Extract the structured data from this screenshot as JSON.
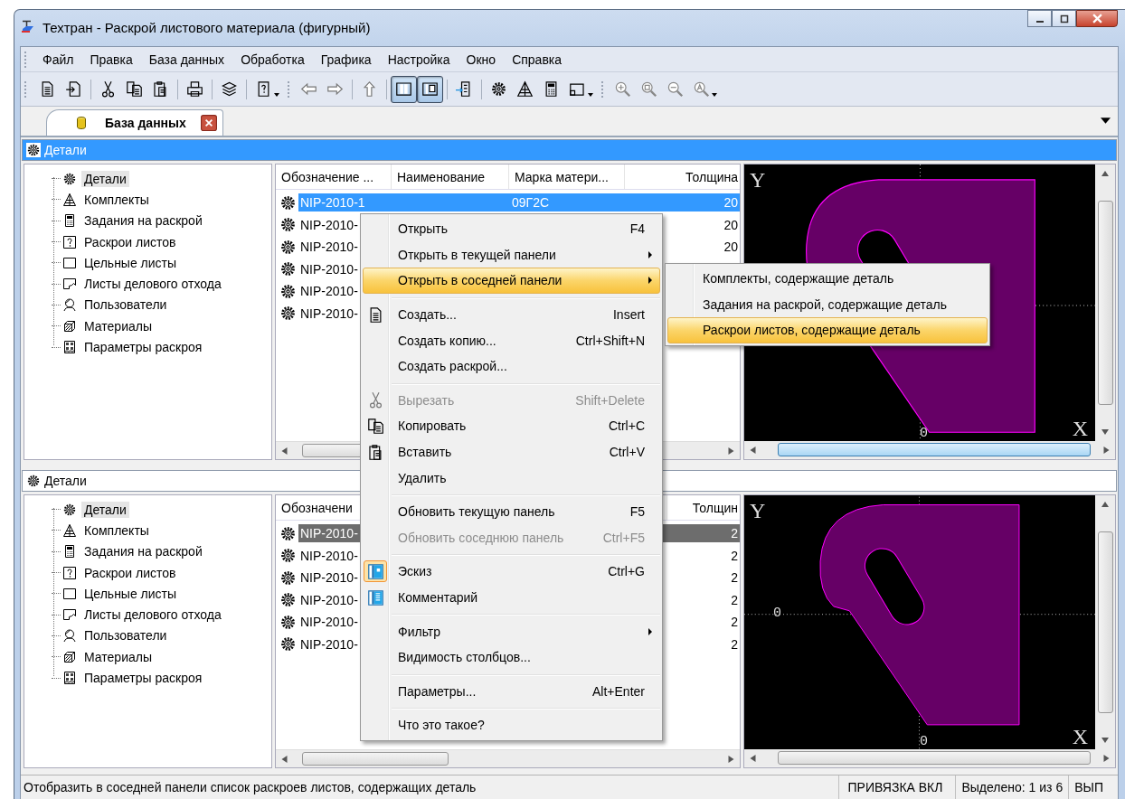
{
  "window": {
    "title": "Техтран - Раскрой листового материала (фигурный)"
  },
  "menu_bar": [
    "Файл",
    "Правка",
    "База данных",
    "Обработка",
    "Графика",
    "Настройка",
    "Окно",
    "Справка"
  ],
  "toolbar": [
    {
      "pressed": false
    },
    {
      "pressed": false
    },
    {
      "pressed": false
    },
    {
      "pressed": false
    },
    {
      "pressed": false
    },
    {
      "pressed": false
    },
    {
      "pressed": false
    },
    {
      "pressed": false
    },
    {
      "pressed": false
    },
    {
      "pressed": false
    },
    {
      "pressed": false
    },
    {
      "pressed": true
    },
    {
      "pressed": true
    },
    {
      "pressed": false
    },
    {
      "pressed": false
    },
    {
      "pressed": false
    },
    {
      "pressed": false
    },
    {
      "pressed": false
    },
    {
      "pressed": false
    },
    {
      "pressed": false
    },
    {
      "pressed": false
    },
    {
      "pressed": false
    }
  ],
  "tabs": [
    {
      "label": "База данных",
      "selected": true
    }
  ],
  "panels": [
    {
      "title": "Детали",
      "active": true,
      "tree": [
        {
          "label": "Детали",
          "selected": true
        },
        {
          "label": "Комплекты",
          "selected": false
        },
        {
          "label": "Задания на раскрой",
          "selected": false
        },
        {
          "label": "Раскрои листов",
          "selected": false
        },
        {
          "label": "Цельные листы",
          "selected": false
        },
        {
          "label": "Листы делового отхода",
          "selected": false
        },
        {
          "label": "Пользователи",
          "selected": false
        },
        {
          "label": "Материалы",
          "selected": false
        },
        {
          "label": "Параметры раскроя",
          "selected": false
        }
      ],
      "table": {
        "columns": [
          "Обозначение ...",
          "Наименование",
          "Марка матери...",
          "Толщина"
        ],
        "rows": [
          {
            "designation": "NIP-2010-1",
            "material": "09Г2С",
            "thickness": "20",
            "selected": true
          },
          {
            "designation": "NIP-2010-",
            "thickness": "20",
            "selected": false
          },
          {
            "designation": "NIP-2010-",
            "thickness": "20",
            "selected": false
          },
          {
            "designation": "NIP-2010-",
            "selected": false
          },
          {
            "designation": "NIP-2010-",
            "selected": false
          },
          {
            "designation": "NIP-2010-",
            "selected": false
          }
        ]
      },
      "preview": {
        "axis_labels": [
          {
            "text": "Y",
            "kind": "y-axis"
          },
          {
            "text": "0",
            "kind": "x-origin"
          },
          {
            "text": "X",
            "kind": "x-axis"
          }
        ]
      }
    },
    {
      "title": "Детали",
      "active": false,
      "tree": [
        {
          "label": "Детали",
          "selected": true
        },
        {
          "label": "Комплекты",
          "selected": false
        },
        {
          "label": "Задания на раскрой",
          "selected": false
        },
        {
          "label": "Раскрои листов",
          "selected": false
        },
        {
          "label": "Цельные листы",
          "selected": false
        },
        {
          "label": "Листы делового отхода",
          "selected": false
        },
        {
          "label": "Пользователи",
          "selected": false
        },
        {
          "label": "Материалы",
          "selected": false
        },
        {
          "label": "Параметры раскроя",
          "selected": false
        }
      ],
      "table": {
        "columns": [
          "Обозначени",
          "Толщин"
        ],
        "rows": [
          {
            "designation": "NIP-2010-",
            "thickness": "2",
            "selected": true
          },
          {
            "designation": "NIP-2010-",
            "thickness": "2",
            "selected": false
          },
          {
            "designation": "NIP-2010-",
            "thickness": "2",
            "selected": false
          },
          {
            "designation": "NIP-2010-",
            "thickness": "2",
            "selected": false
          },
          {
            "designation": "NIP-2010-",
            "thickness": "2",
            "selected": false
          },
          {
            "designation": "NIP-2010-",
            "thickness": "2",
            "selected": false
          }
        ]
      },
      "preview": {
        "axis_labels": [
          {
            "text": "Y",
            "kind": "y-axis"
          },
          {
            "text": "0",
            "kind": "y-origin"
          },
          {
            "text": "X",
            "kind": "x-axis"
          },
          {
            "text": "0",
            "kind": "x-origin"
          }
        ]
      }
    }
  ],
  "context_menu": {
    "items": [
      {
        "kind": "item",
        "label": "Открыть",
        "shortcut": "F4",
        "has_submenu": false,
        "selected": false,
        "disabled": false,
        "checked": false
      },
      {
        "kind": "item",
        "label": "Открыть в текущей панели",
        "has_submenu": true,
        "selected": false,
        "disabled": false,
        "checked": false
      },
      {
        "kind": "item",
        "label": "Открыть в соседней панели",
        "has_submenu": true,
        "selected": true,
        "disabled": false,
        "checked": false
      },
      {
        "kind": "separator"
      },
      {
        "kind": "item",
        "label": "Создать...",
        "shortcut": "Insert",
        "has_submenu": false,
        "selected": false,
        "disabled": false,
        "checked": false
      },
      {
        "kind": "item",
        "label": "Создать копию...",
        "shortcut": "Ctrl+Shift+N",
        "has_submenu": false,
        "selected": false,
        "disabled": false,
        "checked": false
      },
      {
        "kind": "item",
        "label": "Создать раскрой...",
        "has_submenu": false,
        "selected": false,
        "disabled": false,
        "checked": false
      },
      {
        "kind": "separator"
      },
      {
        "kind": "item",
        "label": "Вырезать",
        "shortcut": "Shift+Delete",
        "has_submenu": false,
        "selected": false,
        "disabled": true,
        "checked": false
      },
      {
        "kind": "item",
        "label": "Копировать",
        "shortcut": "Ctrl+C",
        "has_submenu": false,
        "selected": false,
        "disabled": false,
        "checked": false
      },
      {
        "kind": "item",
        "label": "Вставить",
        "shortcut": "Ctrl+V",
        "has_submenu": false,
        "selected": false,
        "disabled": false,
        "checked": false
      },
      {
        "kind": "item",
        "label": "Удалить",
        "has_submenu": false,
        "selected": false,
        "disabled": false,
        "checked": false
      },
      {
        "kind": "separator"
      },
      {
        "kind": "item",
        "label": "Обновить текущую панель",
        "shortcut": "F5",
        "has_submenu": false,
        "selected": false,
        "disabled": false,
        "checked": false
      },
      {
        "kind": "item",
        "label": "Обновить соседнюю панель",
        "shortcut": "Ctrl+F5",
        "has_submenu": false,
        "selected": false,
        "disabled": true,
        "checked": false
      },
      {
        "kind": "separator"
      },
      {
        "kind": "item",
        "label": "Эскиз",
        "shortcut": "Ctrl+G",
        "has_submenu": false,
        "selected": false,
        "disabled": false,
        "checked": true
      },
      {
        "kind": "item",
        "label": "Комментарий",
        "has_submenu": false,
        "selected": false,
        "disabled": false,
        "checked": false
      },
      {
        "kind": "separator"
      },
      {
        "kind": "item",
        "label": "Фильтр",
        "has_submenu": true,
        "selected": false,
        "disabled": false,
        "checked": false
      },
      {
        "kind": "item",
        "label": "Видимость столбцов...",
        "has_submenu": false,
        "selected": false,
        "disabled": false,
        "checked": false
      },
      {
        "kind": "separator"
      },
      {
        "kind": "item",
        "label": "Параметры...",
        "shortcut": "Alt+Enter",
        "has_submenu": false,
        "selected": false,
        "disabled": false,
        "checked": false
      },
      {
        "kind": "separator"
      },
      {
        "kind": "item",
        "label": "Что это такое?",
        "has_submenu": false,
        "selected": false,
        "disabled": false,
        "checked": false
      }
    ]
  },
  "submenu": {
    "items": [
      {
        "label": "Комплекты, содержащие деталь",
        "selected": false
      },
      {
        "label": "Задания на раскрой, содержащие деталь",
        "selected": false
      },
      {
        "label": "Раскрои листов, содержащие деталь",
        "selected": true
      }
    ]
  },
  "status_bar": [
    "Отобразить в соседней панели список раскроев листов, содержащих деталь",
    "ПРИВЯЗКА ВКЛ",
    "Выделено: 1 из 6",
    "ВЫП"
  ]
}
